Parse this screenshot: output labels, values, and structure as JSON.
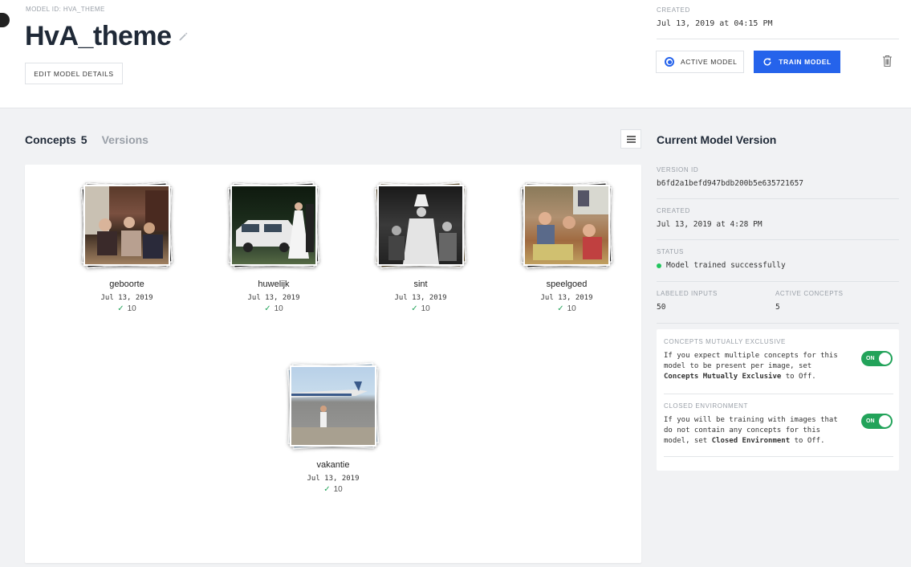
{
  "header": {
    "model_id_label": "MODEL ID: HvA_theme",
    "title": "HvA_theme",
    "edit_button": "EDIT MODEL DETAILS",
    "created_label": "CREATED",
    "created_value": "Jul 13, 2019 at 04:15 PM",
    "active_button": "ACTIVE MODEL",
    "train_button": "TRAIN MODEL"
  },
  "tabs": {
    "concepts_label": "Concepts",
    "concepts_count": "5",
    "versions_label": "Versions"
  },
  "concepts": [
    {
      "name": "geboorte",
      "date": "Jul 13, 2019",
      "count": "10"
    },
    {
      "name": "huwelijk",
      "date": "Jul 13, 2019",
      "count": "10"
    },
    {
      "name": "sint",
      "date": "Jul 13, 2019",
      "count": "10"
    },
    {
      "name": "speelgoed",
      "date": "Jul 13, 2019",
      "count": "10"
    },
    {
      "name": "vakantie",
      "date": "Jul 13, 2019",
      "count": "10"
    }
  ],
  "version": {
    "title": "Current Model Version",
    "version_id_label": "VERSION ID",
    "version_id": "b6fd2a1befd947bdb200b5e635721657",
    "created_label": "CREATED",
    "created_value": "Jul 13, 2019 at 4:28 PM",
    "status_label": "STATUS",
    "status_value": "Model trained successfully",
    "labeled_inputs_label": "LABELED INPUTS",
    "labeled_inputs": "50",
    "active_concepts_label": "ACTIVE CONCEPTS",
    "active_concepts": "5"
  },
  "settings": {
    "exclusive_label": "CONCEPTS MUTUALLY EXCLUSIVE",
    "exclusive_text_1": "If you expect multiple concepts for this model to be present per image, set ",
    "exclusive_bold": "Concepts Mutually Exclusive",
    "exclusive_text_2": " to Off.",
    "exclusive_toggle": "ON",
    "closed_label": "CLOSED ENVIRONMENT",
    "closed_text_1": "If you will be training with images that do not contain any concepts for this model, set ",
    "closed_bold": "Closed Environment",
    "closed_text_2": " to Off.",
    "closed_toggle": "ON"
  },
  "colors": {
    "accent": "#2563eb",
    "success": "#22a35a"
  }
}
